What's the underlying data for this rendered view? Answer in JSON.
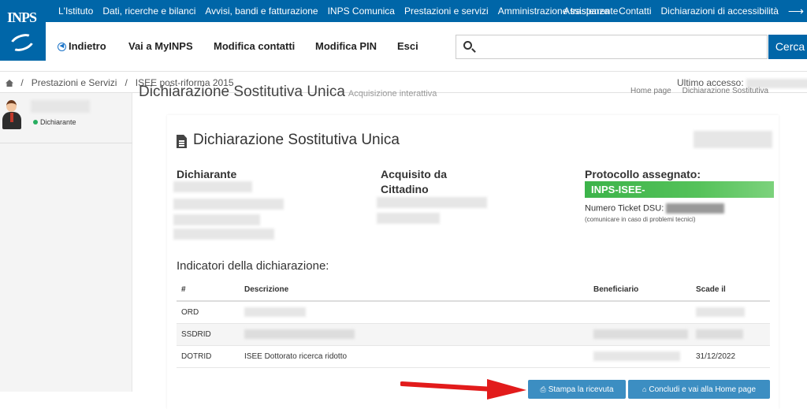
{
  "brand": {
    "logo_text": "INPS"
  },
  "top_nav": {
    "left": [
      "L'Istituto",
      "Dati, ricerche e bilanci",
      "Avvisi, bandi e fatturazione",
      "INPS Comunica",
      "Prestazioni e servizi",
      "Amministrazione trasparente"
    ],
    "right": [
      "Assistenza",
      "Contatti",
      "Dichiarazioni di accessibilità"
    ],
    "share_icon": "share-icon"
  },
  "main_nav": {
    "back": "Indietro",
    "myinps": "Vai a MyINPS",
    "modifica_contatti": "Modifica contatti",
    "modifica_pin": "Modifica PIN",
    "esci": "Esci",
    "search_placeholder": "",
    "search_button": "Cerca"
  },
  "breadcrumb": {
    "items": [
      "Prestazioni e Servizi",
      "ISEE post-riforma 2015"
    ],
    "separator": "/"
  },
  "last_access": {
    "label": "Ultimo accesso:"
  },
  "sidebar": {
    "role": "Dichiarante"
  },
  "page": {
    "title": "Dichiarazione Sostitutiva Unica",
    "subtitle": "Acquisizione interattiva",
    "links": [
      "Home page",
      "Dichiarazione Sostitutiva"
    ]
  },
  "card": {
    "title": "Dichiarazione Sostitutiva Unica",
    "dichiarante_label": "Dichiarante",
    "acquisito_label_1": "Acquisito da",
    "acquisito_label_2": "Cittadino",
    "protocollo_label": "Protocollo assegnato:",
    "protocollo_value": "INPS-ISEE-",
    "ticket_label": "Numero Ticket DSU:",
    "ticket_note": "(comunicare in caso di problemi tecnici)",
    "indicators_title": "Indicatori della dichiarazione:"
  },
  "table": {
    "headers": [
      "#",
      "Descrizione",
      "Beneficiario",
      "Scade il"
    ],
    "rows": [
      {
        "code": "ORD",
        "descrizione": "",
        "scade": ""
      },
      {
        "code": "SSDRID",
        "descrizione": "",
        "scade": ""
      },
      {
        "code": "DOTRID",
        "descrizione": "ISEE Dottorato ricerca ridotto",
        "scade": "31/12/2022"
      }
    ]
  },
  "buttons": {
    "stampa": "Stampa la ricevuta",
    "concludi": "Concludi e vai alla Home page"
  },
  "colors": {
    "brand_blue": "#0066a8",
    "button_blue": "#3c8ec2",
    "protocol_green": "#3cb34a",
    "arrow_red": "#e21b1b"
  }
}
